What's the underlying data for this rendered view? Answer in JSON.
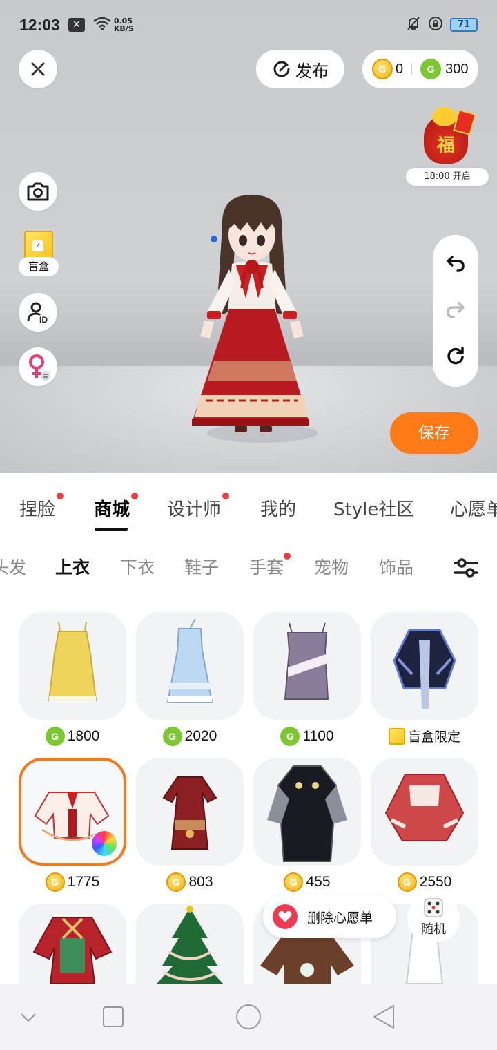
{
  "status_bar": {
    "time": "12:03",
    "net_speed_value": "0.05",
    "net_speed_unit": "KB/S",
    "battery": "71"
  },
  "top_bar": {
    "publish_label": "发布",
    "gold_coins": "0",
    "green_coins": "300"
  },
  "fortune_event": {
    "emblem_char": "福",
    "label": "18:00 开启"
  },
  "left_tools": {
    "blind_box_label": "盲盒"
  },
  "save_label": "保存",
  "main_tabs": [
    {
      "label": "捏脸",
      "dot": true
    },
    {
      "label": "商城",
      "dot": true,
      "active": true
    },
    {
      "label": "设计师",
      "dot": true
    },
    {
      "label": "我的",
      "dot": false
    },
    {
      "label": "Style社区",
      "dot": false
    },
    {
      "label": "心愿单",
      "dot": false
    }
  ],
  "sub_tabs": [
    {
      "label": "头发"
    },
    {
      "label": "上衣",
      "active": true
    },
    {
      "label": "下衣"
    },
    {
      "label": "鞋子"
    },
    {
      "label": "手套",
      "dot": true
    },
    {
      "label": "宠物"
    },
    {
      "label": "饰品"
    }
  ],
  "items": [
    {
      "price": "1800",
      "currency": "green"
    },
    {
      "price": "2020",
      "currency": "green"
    },
    {
      "price": "1100",
      "currency": "green"
    },
    {
      "price": "盲盒限定",
      "currency": "blindbox"
    },
    {
      "price": "1775",
      "currency": "gold",
      "selected": true
    },
    {
      "price": "803",
      "currency": "gold"
    },
    {
      "price": "455",
      "currency": "gold"
    },
    {
      "price": "2550",
      "currency": "gold"
    }
  ],
  "wishlist_remove_label": "删除心愿单",
  "random_label": "随机",
  "colors": {
    "accent_orange": "#fd7a16",
    "selected_border": "#f07a1e",
    "tab_dot": "#f03c3c",
    "green_coin": "#7cc832",
    "gold_coin": "#f4b212"
  }
}
